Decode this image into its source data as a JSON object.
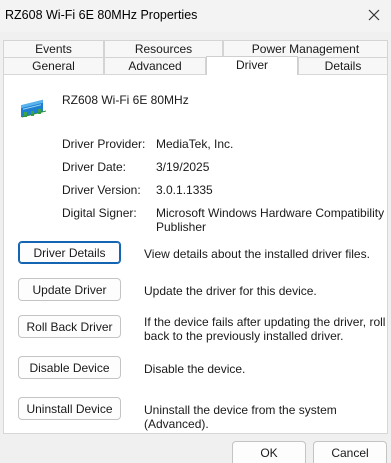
{
  "window": {
    "title": "RZ608 Wi-Fi 6E 80MHz Properties"
  },
  "tabs": {
    "top_row": [
      "Events",
      "Resources",
      "Power Management"
    ],
    "bottom_row": [
      "General",
      "Advanced",
      "Driver",
      "Details"
    ],
    "active": "Driver"
  },
  "device": {
    "name": "RZ608 Wi-Fi 6E 80MHz",
    "icon": "network-adapter-icon"
  },
  "info": [
    {
      "label": "Driver Provider:",
      "value": "MediaTek, Inc."
    },
    {
      "label": "Driver Date:",
      "value": "3/19/2025"
    },
    {
      "label": "Driver Version:",
      "value": "3.0.1.1335"
    },
    {
      "label": "Digital Signer:",
      "value": "Microsoft Windows Hardware Compatibility Publisher"
    }
  ],
  "signer_lines": [
    "Microsoft Windows Hardware Compatibility",
    "Publisher"
  ],
  "actions": [
    {
      "label": "Driver Details",
      "desc": [
        "View details about the installed driver files."
      ]
    },
    {
      "label": "Update Driver",
      "desc": [
        "Update the driver for this device."
      ]
    },
    {
      "label": "Roll Back Driver",
      "desc": [
        "If the device fails after updating the driver, roll",
        "back to the previously installed driver."
      ]
    },
    {
      "label": "Disable Device",
      "desc": [
        "Disable the device."
      ]
    },
    {
      "label": "Uninstall Device",
      "desc": [
        "Uninstall the device from the system (Advanced)."
      ]
    }
  ],
  "footer": {
    "ok": "OK",
    "cancel": "Cancel"
  },
  "colors": {
    "focus_border": "#1464b4",
    "icon_blue": "#2a8fd6",
    "icon_green": "#3aa64a"
  }
}
